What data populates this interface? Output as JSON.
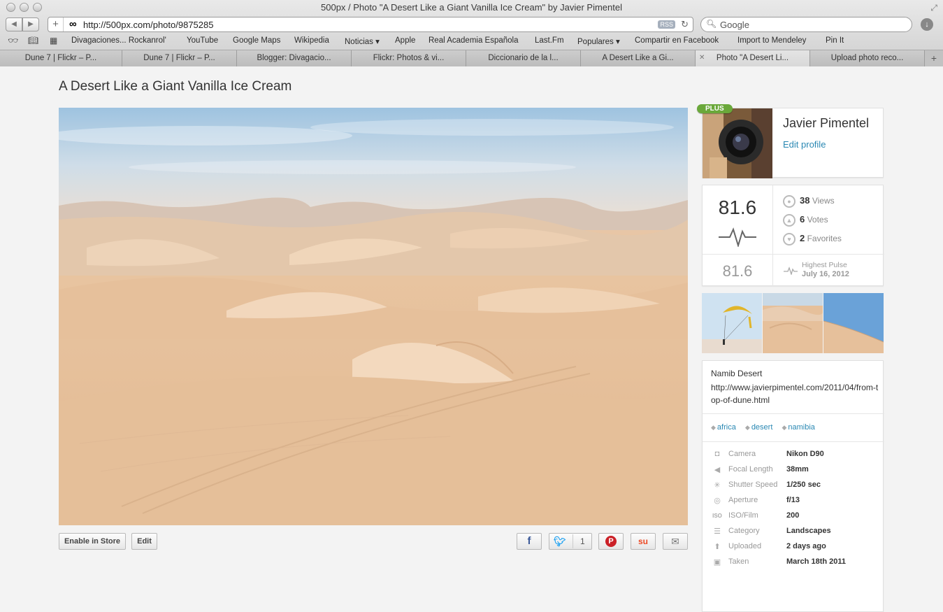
{
  "window": {
    "title": "500px / Photo \"A Desert Like a Giant Vanilla Ice Cream\" by Javier Pimentel"
  },
  "toolbar": {
    "url": "http://500px.com/photo/9875285",
    "rss_label": "RSS",
    "search_placeholder": "Google"
  },
  "bookmarks": [
    {
      "label": "Divagaciones... Rockanrol'"
    },
    {
      "label": "YouTube"
    },
    {
      "label": "Google Maps"
    },
    {
      "label": "Wikipedia"
    },
    {
      "label": "Noticias ▾"
    },
    {
      "label": "Apple"
    },
    {
      "label": "Real Academia Española"
    },
    {
      "label": "Last.Fm"
    },
    {
      "label": "Populares ▾"
    },
    {
      "label": "Compartir en Facebook"
    },
    {
      "label": "Import to Mendeley"
    },
    {
      "label": "Pin It"
    }
  ],
  "tabs": [
    {
      "label": "Dune 7 | Flickr – P..."
    },
    {
      "label": "Dune 7 | Flickr – P..."
    },
    {
      "label": "Blogger: Divagacio..."
    },
    {
      "label": "Flickr: Photos & vi..."
    },
    {
      "label": "Diccionario de la l..."
    },
    {
      "label": "A Desert Like a Gi..."
    },
    {
      "label": "Photo \"A Desert Li..."
    },
    {
      "label": "Upload photo reco..."
    }
  ],
  "photo": {
    "title": "A Desert Like a Giant Vanilla Ice Cream"
  },
  "actions": {
    "store": "Enable in Store",
    "edit": "Edit"
  },
  "share": {
    "facebook": "f",
    "twitter_count": "1",
    "pinterest": "P",
    "stumbleupon": "su",
    "email": "✉"
  },
  "author": {
    "badge": "PLUS",
    "name": "Javier Pimentel",
    "edit_label": "Edit profile"
  },
  "stats": {
    "pulse": "81.6",
    "views": {
      "count": "38",
      "label": "Views"
    },
    "votes": {
      "count": "6",
      "label": "Votes"
    },
    "favorites": {
      "count": "2",
      "label": "Favorites"
    },
    "highest_pulse_value": "81.6",
    "highest_pulse_label": "Highest Pulse",
    "highest_pulse_date": "July 16, 2012"
  },
  "description": {
    "line1": "Namib Desert",
    "line2": "http://www.javierpimentel.com/2011/04/from-top-of-dune.html"
  },
  "tags": [
    "africa",
    "desert",
    "namibia"
  ],
  "exif": [
    {
      "icon": "camera-icon",
      "label": "Camera",
      "value": "Nikon D90"
    },
    {
      "icon": "focal-length-icon",
      "label": "Focal Length",
      "value": "38mm"
    },
    {
      "icon": "shutter-speed-icon",
      "label": "Shutter Speed",
      "value": "1/250 sec"
    },
    {
      "icon": "aperture-icon",
      "label": "Aperture",
      "value": "f/13"
    },
    {
      "icon": "iso-icon",
      "label": "ISO/Film",
      "value": "200"
    },
    {
      "icon": "category-icon",
      "label": "Category",
      "value": "Landscapes"
    },
    {
      "icon": "uploaded-icon",
      "label": "Uploaded",
      "value": "2 days ago"
    },
    {
      "icon": "taken-icon",
      "label": "Taken",
      "value": "March 18th 2011"
    }
  ],
  "colors": {
    "accent": "#2a88b3",
    "plus_badge": "#6aa83a"
  }
}
